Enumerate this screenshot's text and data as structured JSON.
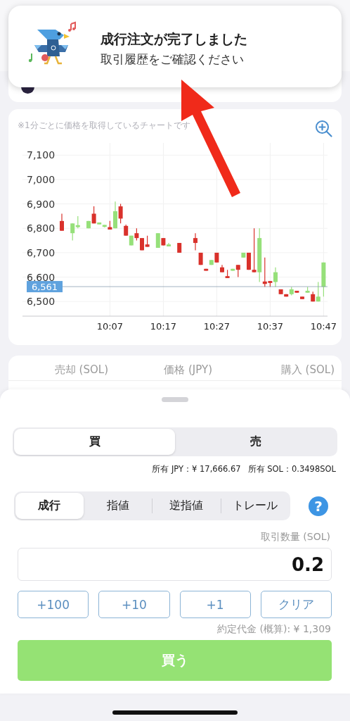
{
  "notification": {
    "title": "成行注文が完了しました",
    "message": "取引履歴をご確認ください"
  },
  "chart": {
    "note": "※1分ごとに価格を取得しているチャートです",
    "chart_data": {
      "type": "candlestick",
      "categories": [
        null,
        null,
        null,
        null,
        null,
        null,
        null,
        null,
        null,
        "10:07",
        null,
        null,
        null,
        null,
        null,
        null,
        null,
        null,
        null,
        "10:17",
        null,
        null,
        null,
        null,
        null,
        null,
        null,
        null,
        null,
        "10:27",
        null,
        null,
        null,
        null,
        null,
        null,
        null,
        null,
        null,
        "10:37",
        null,
        null,
        null,
        null,
        null,
        null,
        null,
        null,
        null,
        "10:47"
      ],
      "ohlc": [
        [
          6830,
          6860,
          6790,
          6790
        ],
        null,
        [
          6780,
          6820,
          6750,
          6820
        ],
        [
          6805,
          6850,
          6800,
          6813
        ],
        null,
        [
          6800,
          6830,
          6800,
          6830
        ],
        [
          6860,
          6890,
          6820,
          6820
        ],
        [
          6816,
          6824,
          6816,
          6824
        ],
        [
          6806,
          6814,
          6804,
          6814
        ],
        [
          6805,
          6830,
          6795,
          6795
        ],
        [
          6800,
          6910,
          6800,
          6870
        ],
        [
          6890,
          6900,
          6820,
          6840
        ],
        [
          6810,
          6815,
          6770,
          6770
        ],
        [
          6730,
          6770,
          6730,
          6770
        ],
        [
          6780,
          6800,
          6750,
          6760
        ],
        [
          6760,
          6760,
          6710,
          6710
        ],
        [
          6734,
          6770,
          6724,
          6724
        ],
        null,
        [
          6720,
          6780,
          6720,
          6780
        ],
        [
          6760,
          6760,
          6730,
          6730
        ],
        [
          6726,
          6740,
          6726,
          6734
        ],
        null,
        [
          6740,
          6740,
          6700,
          6700
        ],
        null,
        null,
        [
          6760,
          6780,
          6710,
          6740
        ],
        [
          6700,
          6700,
          6650,
          6650
        ],
        [
          6634,
          6634,
          6626,
          6626
        ],
        [
          6650,
          6670,
          6650,
          6670
        ],
        [
          6700,
          6700,
          6660,
          6660
        ],
        [
          6640,
          6650,
          6620,
          6620
        ],
        [
          6604,
          6630,
          6596,
          6596
        ],
        [
          6626,
          6634,
          6626,
          6634
        ],
        [
          6650,
          6650,
          6600,
          6630
        ],
        [
          6680,
          6700,
          6680,
          6700
        ],
        [
          6700,
          6700,
          6630,
          6630
        ],
        [
          6630,
          6800,
          6620,
          6620
        ],
        [
          6620,
          6800,
          6580,
          6760
        ],
        [
          6582,
          6680,
          6560,
          6572
        ],
        [
          6584,
          6584,
          6560,
          6576
        ],
        [
          6580,
          6640,
          6560,
          6620
        ],
        [
          6550,
          6550,
          6530,
          6530
        ],
        [
          6530,
          6530,
          6520,
          6520
        ],
        [
          6530,
          6560,
          6525,
          6550
        ],
        [
          6544,
          6544,
          6536,
          6536
        ],
        [
          6520,
          6520,
          6510,
          6510
        ],
        [
          6536,
          6560,
          6536,
          6544
        ],
        [
          6530,
          6540,
          6500,
          6500
        ],
        [
          6500,
          6580,
          6500,
          6520
        ],
        [
          6560,
          6660,
          6520,
          6660
        ]
      ],
      "ylim": [
        6440,
        7150
      ],
      "grid": true,
      "ref_lines": [
        {
          "axis": "y",
          "value": 6561,
          "label": "6,561"
        }
      ],
      "yticks": [
        {
          "value": 7100,
          "label": "7,100"
        },
        {
          "value": 7000,
          "label": "7,000"
        },
        {
          "value": 6900,
          "label": "6,900"
        },
        {
          "value": 6800,
          "label": "6,800"
        },
        {
          "value": 6700,
          "label": "6,700"
        },
        {
          "value": 6600,
          "label": "6,600"
        },
        {
          "value": 6500,
          "label": "6,500"
        }
      ]
    }
  },
  "order_book": {
    "columns": [
      "売却 (SOL)",
      "価格 (JPY)",
      "購入 (SOL)"
    ]
  },
  "order_panel": {
    "side_tabs": [
      {
        "label": "買",
        "selected": true
      },
      {
        "label": "売",
        "selected": false
      }
    ],
    "balances": [
      "所有 JPY：¥ 17,666.67",
      "所有 SOL：0.3498SOL"
    ],
    "order_types": [
      {
        "label": "成行",
        "selected": true
      },
      {
        "label": "指値",
        "selected": false
      },
      {
        "label": "逆指値",
        "selected": false
      },
      {
        "label": "トレール",
        "selected": false
      }
    ],
    "help": "?",
    "quantity_label": "取引数量 (SOL)",
    "quantity_value": "0.2",
    "quick_buttons": [
      "+100",
      "+10",
      "+1",
      "クリア"
    ],
    "estimate": "約定代金 (概算): ¥ 1,309",
    "submit": "買う"
  }
}
